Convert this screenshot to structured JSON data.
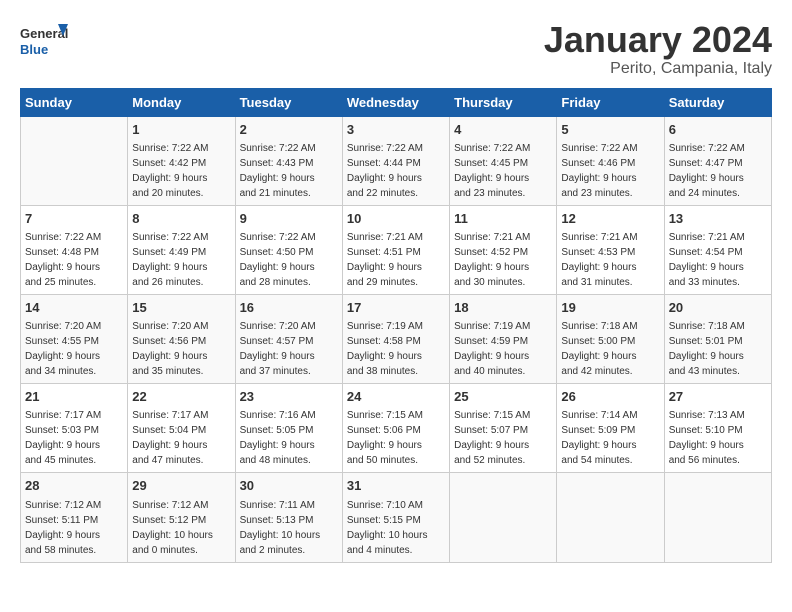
{
  "header": {
    "logo_line1": "General",
    "logo_line2": "Blue",
    "month": "January 2024",
    "location": "Perito, Campania, Italy"
  },
  "days_of_week": [
    "Sunday",
    "Monday",
    "Tuesday",
    "Wednesday",
    "Thursday",
    "Friday",
    "Saturday"
  ],
  "weeks": [
    [
      {
        "day": "",
        "info": ""
      },
      {
        "day": "1",
        "info": "Sunrise: 7:22 AM\nSunset: 4:42 PM\nDaylight: 9 hours\nand 20 minutes."
      },
      {
        "day": "2",
        "info": "Sunrise: 7:22 AM\nSunset: 4:43 PM\nDaylight: 9 hours\nand 21 minutes."
      },
      {
        "day": "3",
        "info": "Sunrise: 7:22 AM\nSunset: 4:44 PM\nDaylight: 9 hours\nand 22 minutes."
      },
      {
        "day": "4",
        "info": "Sunrise: 7:22 AM\nSunset: 4:45 PM\nDaylight: 9 hours\nand 23 minutes."
      },
      {
        "day": "5",
        "info": "Sunrise: 7:22 AM\nSunset: 4:46 PM\nDaylight: 9 hours\nand 23 minutes."
      },
      {
        "day": "6",
        "info": "Sunrise: 7:22 AM\nSunset: 4:47 PM\nDaylight: 9 hours\nand 24 minutes."
      }
    ],
    [
      {
        "day": "7",
        "info": "Sunrise: 7:22 AM\nSunset: 4:48 PM\nDaylight: 9 hours\nand 25 minutes."
      },
      {
        "day": "8",
        "info": "Sunrise: 7:22 AM\nSunset: 4:49 PM\nDaylight: 9 hours\nand 26 minutes."
      },
      {
        "day": "9",
        "info": "Sunrise: 7:22 AM\nSunset: 4:50 PM\nDaylight: 9 hours\nand 28 minutes."
      },
      {
        "day": "10",
        "info": "Sunrise: 7:21 AM\nSunset: 4:51 PM\nDaylight: 9 hours\nand 29 minutes."
      },
      {
        "day": "11",
        "info": "Sunrise: 7:21 AM\nSunset: 4:52 PM\nDaylight: 9 hours\nand 30 minutes."
      },
      {
        "day": "12",
        "info": "Sunrise: 7:21 AM\nSunset: 4:53 PM\nDaylight: 9 hours\nand 31 minutes."
      },
      {
        "day": "13",
        "info": "Sunrise: 7:21 AM\nSunset: 4:54 PM\nDaylight: 9 hours\nand 33 minutes."
      }
    ],
    [
      {
        "day": "14",
        "info": "Sunrise: 7:20 AM\nSunset: 4:55 PM\nDaylight: 9 hours\nand 34 minutes."
      },
      {
        "day": "15",
        "info": "Sunrise: 7:20 AM\nSunset: 4:56 PM\nDaylight: 9 hours\nand 35 minutes."
      },
      {
        "day": "16",
        "info": "Sunrise: 7:20 AM\nSunset: 4:57 PM\nDaylight: 9 hours\nand 37 minutes."
      },
      {
        "day": "17",
        "info": "Sunrise: 7:19 AM\nSunset: 4:58 PM\nDaylight: 9 hours\nand 38 minutes."
      },
      {
        "day": "18",
        "info": "Sunrise: 7:19 AM\nSunset: 4:59 PM\nDaylight: 9 hours\nand 40 minutes."
      },
      {
        "day": "19",
        "info": "Sunrise: 7:18 AM\nSunset: 5:00 PM\nDaylight: 9 hours\nand 42 minutes."
      },
      {
        "day": "20",
        "info": "Sunrise: 7:18 AM\nSunset: 5:01 PM\nDaylight: 9 hours\nand 43 minutes."
      }
    ],
    [
      {
        "day": "21",
        "info": "Sunrise: 7:17 AM\nSunset: 5:03 PM\nDaylight: 9 hours\nand 45 minutes."
      },
      {
        "day": "22",
        "info": "Sunrise: 7:17 AM\nSunset: 5:04 PM\nDaylight: 9 hours\nand 47 minutes."
      },
      {
        "day": "23",
        "info": "Sunrise: 7:16 AM\nSunset: 5:05 PM\nDaylight: 9 hours\nand 48 minutes."
      },
      {
        "day": "24",
        "info": "Sunrise: 7:15 AM\nSunset: 5:06 PM\nDaylight: 9 hours\nand 50 minutes."
      },
      {
        "day": "25",
        "info": "Sunrise: 7:15 AM\nSunset: 5:07 PM\nDaylight: 9 hours\nand 52 minutes."
      },
      {
        "day": "26",
        "info": "Sunrise: 7:14 AM\nSunset: 5:09 PM\nDaylight: 9 hours\nand 54 minutes."
      },
      {
        "day": "27",
        "info": "Sunrise: 7:13 AM\nSunset: 5:10 PM\nDaylight: 9 hours\nand 56 minutes."
      }
    ],
    [
      {
        "day": "28",
        "info": "Sunrise: 7:12 AM\nSunset: 5:11 PM\nDaylight: 9 hours\nand 58 minutes."
      },
      {
        "day": "29",
        "info": "Sunrise: 7:12 AM\nSunset: 5:12 PM\nDaylight: 10 hours\nand 0 minutes."
      },
      {
        "day": "30",
        "info": "Sunrise: 7:11 AM\nSunset: 5:13 PM\nDaylight: 10 hours\nand 2 minutes."
      },
      {
        "day": "31",
        "info": "Sunrise: 7:10 AM\nSunset: 5:15 PM\nDaylight: 10 hours\nand 4 minutes."
      },
      {
        "day": "",
        "info": ""
      },
      {
        "day": "",
        "info": ""
      },
      {
        "day": "",
        "info": ""
      }
    ]
  ]
}
